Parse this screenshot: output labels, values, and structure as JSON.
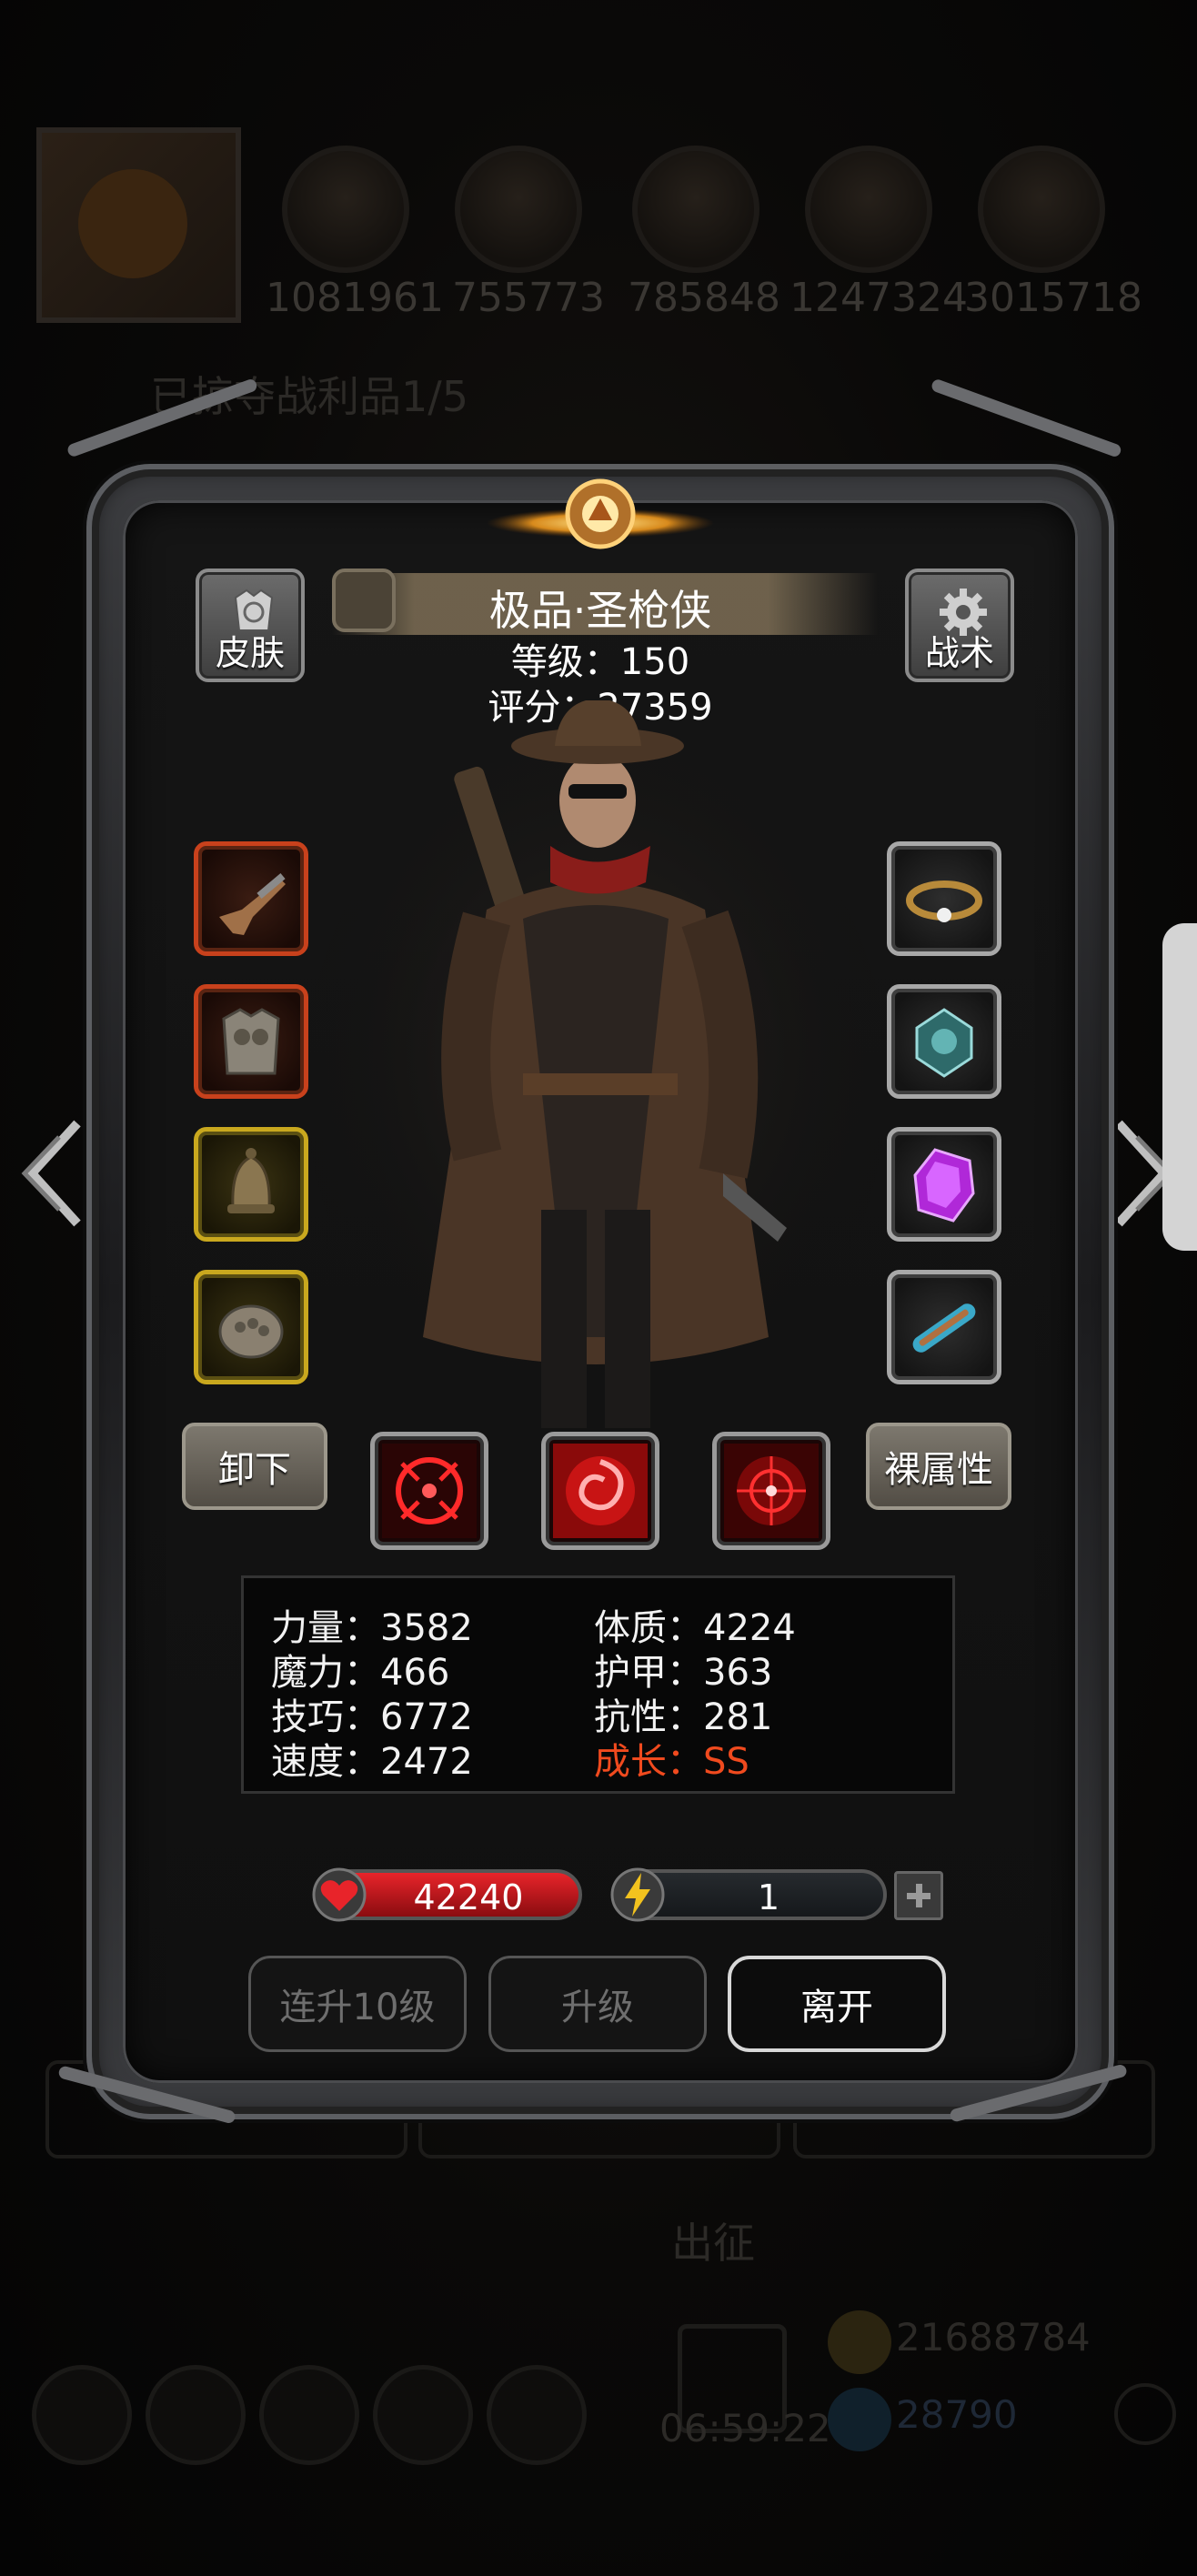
{
  "background": {
    "resources": [
      "1081961",
      "755773",
      "785848",
      "1247324",
      "3015718"
    ],
    "progress_text": "已掠夺战利品1/5",
    "march_label": "出征",
    "timer": "06:59:22",
    "gold": "21688784",
    "gems": "28790"
  },
  "hero": {
    "name": "极品·圣枪侠",
    "level_text": "等级：150",
    "score_text": "评分：27359"
  },
  "top_buttons": {
    "skin": "皮肤",
    "tactics": "战术"
  },
  "mid_buttons": {
    "unequip": "卸下",
    "base_attrs": "裸属性"
  },
  "stats": {
    "strength": "力量：3582",
    "magic": "魔力：466",
    "skill": "技巧：6772",
    "speed": "速度：2472",
    "constitution": "体质：4224",
    "armor": "护甲：363",
    "resistance": "抗性：281",
    "growth": "成长：SS"
  },
  "bars": {
    "hp": "42240",
    "energy": "1"
  },
  "actions": {
    "upgrade10": "连升10级",
    "upgrade": "升级",
    "leave": "离开"
  },
  "colors": {
    "growth": "#f04a1e",
    "hp": "#e8242a",
    "slot_red": "#c8411c",
    "slot_gold": "#c9a81e"
  }
}
